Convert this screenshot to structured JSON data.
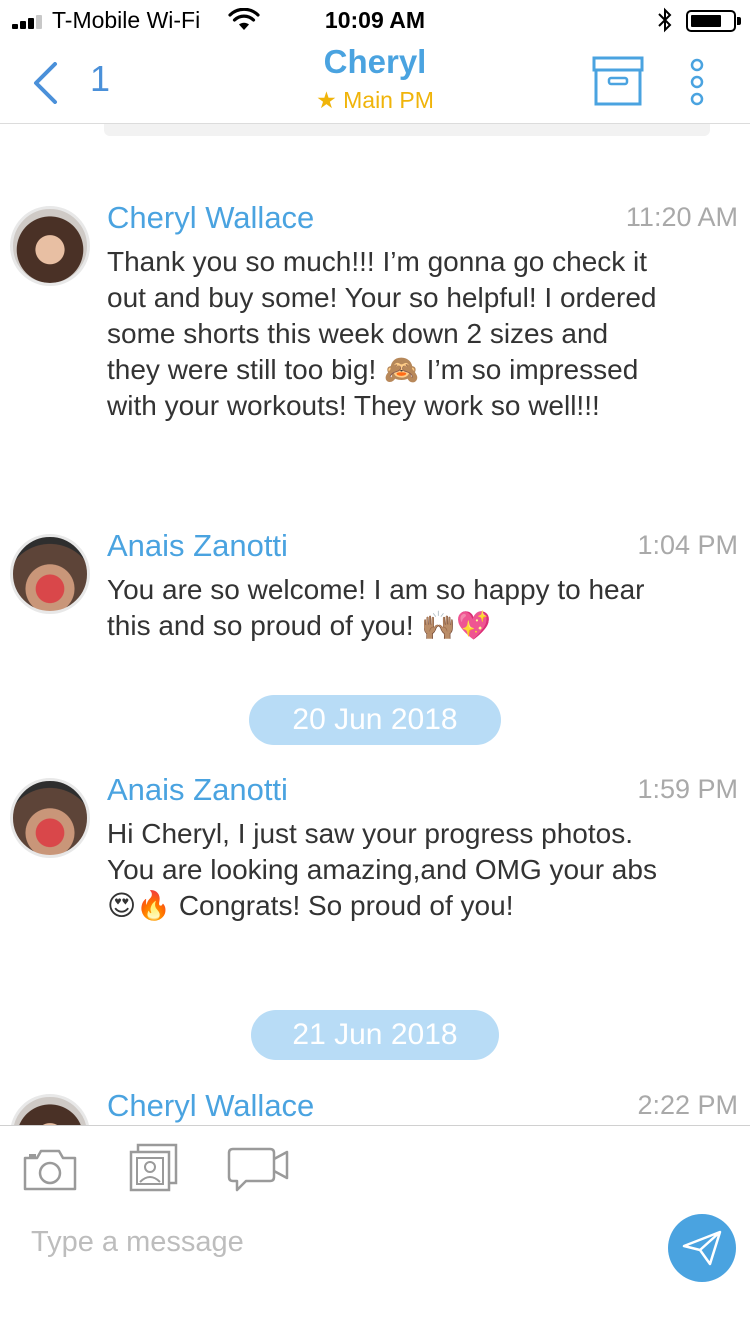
{
  "status_bar": {
    "carrier": "T-Mobile Wi-Fi",
    "time": "10:09 AM",
    "signal_icon": "signal-icon",
    "wifi_icon": "wifi-icon",
    "bluetooth_icon": "bluetooth-icon",
    "battery_icon": "battery-icon"
  },
  "header": {
    "back_count": "1",
    "title": "Cheryl",
    "subtitle": "★ Main PM",
    "accent_color": "#4aa3e0",
    "subtitle_color": "#f0b40a"
  },
  "messages": [
    {
      "sender": "Cheryl Wallace",
      "time": "11:20 AM",
      "text": "Thank you so much!!! I’m gonna go check it out and buy some! Your so helpful! I ordered some shorts this week down 2 sizes and they were still too big! 🙈 I’m so impressed with your workouts! They work so well!!!"
    },
    {
      "sender": "Anais Zanotti",
      "time": "1:04 PM",
      "text": "You are so welcome! I am so happy to hear this and so proud of you! 🙌🏽💖"
    },
    {
      "sender": "Anais Zanotti",
      "time": "1:59 PM",
      "text": "Hi Cheryl, I just saw your progress photos. You are looking amazing,and OMG your abs 😍🔥 Congrats! So proud of you!"
    },
    {
      "sender": "Cheryl Wallace",
      "time": "2:22 PM",
      "text": ""
    }
  ],
  "date_separators": [
    "20 Jun 2018",
    "21 Jun 2018"
  ],
  "composer": {
    "placeholder": "Type a message",
    "camera_icon": "camera-icon",
    "gallery_icon": "gallery-icon",
    "video_icon": "video-camera-icon",
    "send_icon": "send-icon"
  }
}
